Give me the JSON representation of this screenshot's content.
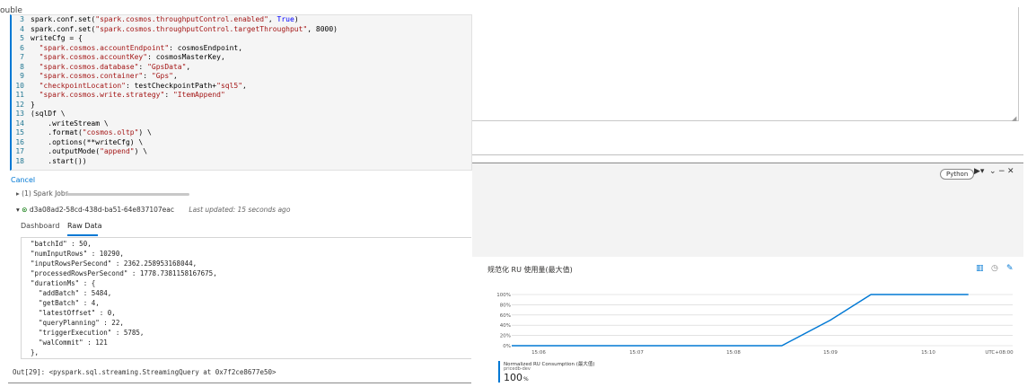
{
  "clip_label": "ouble",
  "code": {
    "lines": [
      {
        "n": "3",
        "tokens": [
          {
            "t": "spark.conf.set(",
            "c": "plain"
          },
          {
            "t": "\"spark.cosmos.throughputControl.enabled\"",
            "c": "str"
          },
          {
            "t": ", ",
            "c": "plain"
          },
          {
            "t": "True",
            "c": "kw"
          },
          {
            "t": ")",
            "c": "plain"
          }
        ]
      },
      {
        "n": "4",
        "tokens": [
          {
            "t": "spark.conf.set(",
            "c": "plain"
          },
          {
            "t": "\"spark.cosmos.throughputControl.targetThroughput\"",
            "c": "str"
          },
          {
            "t": ", 8000)",
            "c": "plain"
          }
        ]
      },
      {
        "n": "5",
        "tokens": [
          {
            "t": "writeCfg = {",
            "c": "plain"
          }
        ]
      },
      {
        "n": "6",
        "tokens": [
          {
            "t": "  ",
            "c": "plain"
          },
          {
            "t": "\"spark.cosmos.accountEndpoint\"",
            "c": "str"
          },
          {
            "t": ": cosmosEndpoint,",
            "c": "plain"
          }
        ]
      },
      {
        "n": "7",
        "tokens": [
          {
            "t": "  ",
            "c": "plain"
          },
          {
            "t": "\"spark.cosmos.accountKey\"",
            "c": "str"
          },
          {
            "t": ": cosmosMasterKey,",
            "c": "plain"
          }
        ]
      },
      {
        "n": "8",
        "tokens": [
          {
            "t": "  ",
            "c": "plain"
          },
          {
            "t": "\"spark.cosmos.database\"",
            "c": "str"
          },
          {
            "t": ": ",
            "c": "plain"
          },
          {
            "t": "\"GpsData\"",
            "c": "str"
          },
          {
            "t": ",",
            "c": "plain"
          }
        ]
      },
      {
        "n": "9",
        "tokens": [
          {
            "t": "  ",
            "c": "plain"
          },
          {
            "t": "\"spark.cosmos.container\"",
            "c": "str"
          },
          {
            "t": ": ",
            "c": "plain"
          },
          {
            "t": "\"Gps\"",
            "c": "str"
          },
          {
            "t": ",",
            "c": "plain"
          }
        ]
      },
      {
        "n": "10",
        "tokens": [
          {
            "t": "  ",
            "c": "plain"
          },
          {
            "t": "\"checkpointLocation\"",
            "c": "str"
          },
          {
            "t": ": testCheckpointPath+",
            "c": "plain"
          },
          {
            "t": "\"sql5\"",
            "c": "str"
          },
          {
            "t": ",",
            "c": "plain"
          }
        ]
      },
      {
        "n": "11",
        "tokens": [
          {
            "t": "  ",
            "c": "plain"
          },
          {
            "t": "\"spark.cosmos.write.strategy\"",
            "c": "str"
          },
          {
            "t": ": ",
            "c": "plain"
          },
          {
            "t": "\"ItemAppend\"",
            "c": "str"
          }
        ]
      },
      {
        "n": "12",
        "tokens": [
          {
            "t": "}",
            "c": "plain"
          }
        ]
      },
      {
        "n": "13",
        "tokens": [
          {
            "t": "(sqlDf \\",
            "c": "plain"
          }
        ]
      },
      {
        "n": "14",
        "tokens": [
          {
            "t": "    .writeStream \\",
            "c": "plain"
          }
        ]
      },
      {
        "n": "15",
        "tokens": [
          {
            "t": "    .format(",
            "c": "plain"
          },
          {
            "t": "\"cosmos.oltp\"",
            "c": "str"
          },
          {
            "t": ") \\",
            "c": "plain"
          }
        ]
      },
      {
        "n": "16",
        "tokens": [
          {
            "t": "    .options(**writeCfg) \\",
            "c": "plain"
          }
        ]
      },
      {
        "n": "17",
        "tokens": [
          {
            "t": "    .outputMode(",
            "c": "plain"
          },
          {
            "t": "\"append\"",
            "c": "str"
          },
          {
            "t": ") \\",
            "c": "plain"
          }
        ]
      },
      {
        "n": "18",
        "tokens": [
          {
            "t": "    .start())",
            "c": "plain"
          }
        ]
      }
    ]
  },
  "output": {
    "cancel": "Cancel",
    "spark_jobs": "(1) Spark Jobs",
    "stream_id": "d3a08ad2-58cd-438d-ba51-64e837107eac",
    "last_updated": "Last updated: 15 seconds ago",
    "tabs": {
      "dashboard": "Dashboard",
      "raw": "Raw Data"
    },
    "raw_lines": [
      "\"batchId\" : 50,",
      "\"numInputRows\" : 10290,",
      "\"inputRowsPerSecond\" : 2362.258953168044,",
      "\"processedRowsPerSecond\" : 1778.7381158167675,",
      "\"durationMs\" : {",
      "  \"addBatch\" : 5484,",
      "  \"getBatch\" : 4,",
      "  \"latestOffset\" : 0,",
      "  \"queryPlanning\" : 22,",
      "  \"triggerExecution\" : 5785,",
      "  \"walCommit\" : 121",
      "},"
    ],
    "out_line": "Out[29]: <pyspark.sql.streaming.StreamingQuery at 0x7f2ce8677e50>"
  },
  "toolbar": {
    "language": "Python",
    "icons": [
      "run-icon",
      "chevron-down-icon",
      "collapse-icon",
      "minimize-icon",
      "close-icon"
    ]
  },
  "chart": {
    "title": "规范化 RU 使用量(最大值)",
    "legend_name": "Normalized RU Consumption (最大值)",
    "legend_sub": "pricedb-dev",
    "legend_value": "100",
    "legend_unit": "%",
    "accent": "#0078d4"
  },
  "chart_data": {
    "type": "line",
    "title": "规范化 RU 使用量(最大值)",
    "x": [
      "15:05",
      "15:06",
      "15:07",
      "15:08",
      "15:08:30",
      "15:09",
      "15:09:25",
      "15:10",
      "15:10:25"
    ],
    "x_ticks": [
      "15:06",
      "15:07",
      "15:08",
      "15:09",
      "15:10",
      "UTC+08:00"
    ],
    "y_ticks": [
      "100%",
      "80%",
      "60%",
      "40%",
      "20%",
      "0%"
    ],
    "ylim": [
      0,
      100
    ],
    "series": [
      {
        "name": "Normalized RU Consumption (最大值)",
        "values": [
          0,
          0,
          0,
          0,
          0,
          50,
          100,
          100,
          100
        ]
      }
    ],
    "grid": true,
    "legend": "bottom-left"
  }
}
